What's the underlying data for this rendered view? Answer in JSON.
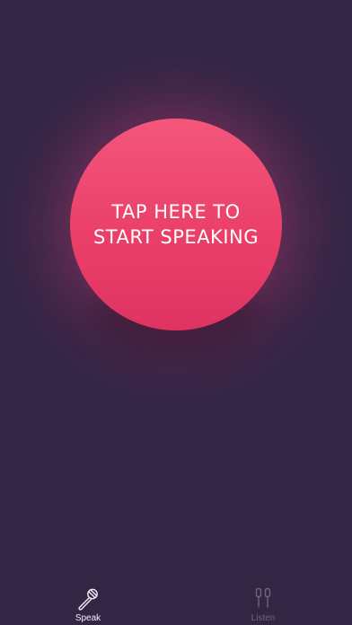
{
  "main": {
    "speak_button": {
      "line1": "TAP HERE TO",
      "line2": "START SPEAKING"
    }
  },
  "tabbar": {
    "tabs": [
      {
        "label": "Speak",
        "icon": "microphone-icon",
        "active": true
      },
      {
        "label": "Listen",
        "icon": "earphones-icon",
        "active": false
      }
    ]
  },
  "colors": {
    "background": "#322644",
    "accent": "#ea3f69",
    "active_tab": "#f2eef6",
    "inactive_tab": "#6f647f"
  }
}
